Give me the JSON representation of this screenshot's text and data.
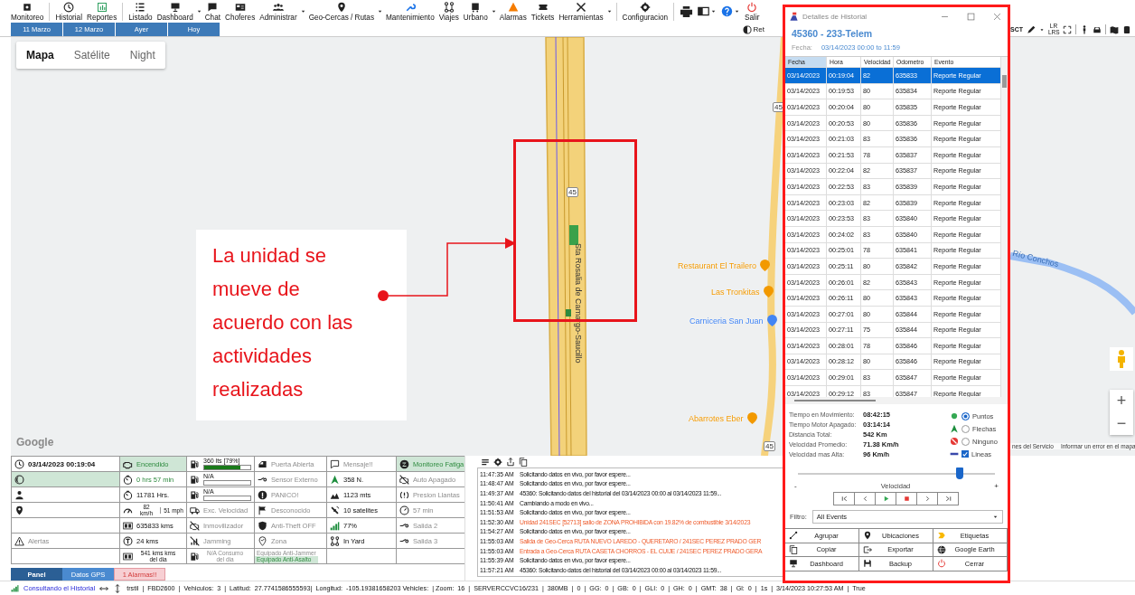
{
  "toolbar": [
    {
      "label": "Monitoreo",
      "dropdown": false
    },
    {
      "label": "Historial",
      "dropdown": false
    },
    {
      "label": "Reportes",
      "dropdown": false
    },
    {
      "label": "Listado",
      "dropdown": false
    },
    {
      "label": "Dashboard",
      "dropdown": true
    },
    {
      "label": "Chat",
      "dropdown": false
    },
    {
      "label": "Choferes",
      "dropdown": false
    },
    {
      "label": "Administrar",
      "dropdown": true
    },
    {
      "label": "Geo-Cercas / Rutas",
      "dropdown": true
    },
    {
      "label": "Mantenimiento",
      "dropdown": false
    },
    {
      "label": "Viajes",
      "dropdown": false
    },
    {
      "label": "Urbano",
      "dropdown": true
    },
    {
      "label": "Alarmas",
      "dropdown": false
    },
    {
      "label": "Tickets",
      "dropdown": false
    },
    {
      "label": "Herramientas",
      "dropdown": true
    },
    {
      "label": "Configuracion",
      "dropdown": false
    }
  ],
  "exit_label": "Salir",
  "date_tabs": [
    {
      "label": "11 Marzo"
    },
    {
      "label": "12 Marzo"
    },
    {
      "label": "Ayer"
    },
    {
      "label": "Hoy"
    }
  ],
  "right_tools": {
    "ret_label": "Ret",
    "sct_label": "SCT",
    "lr_label": "LR LRS"
  },
  "map": {
    "view_buttons": [
      {
        "label": "Mapa",
        "selected": true
      },
      {
        "label": "Satélite",
        "selected": false
      },
      {
        "label": "Night",
        "selected": false
      }
    ],
    "places": [
      {
        "name": "Restaurant El Trailero",
        "color": "#f29900"
      },
      {
        "name": "Las Tronkitas",
        "color": "#f29900"
      },
      {
        "name": "Carniceria San Juan",
        "color": "#4285f4"
      },
      {
        "name": "Abarrotes Eber",
        "color": "#f29900"
      }
    ],
    "road_name": "Sta Rosalia de Camargo-Saucillo",
    "route_shields": [
      "45",
      "45",
      "45"
    ],
    "river_name": "Río Conchos",
    "logo": "Google",
    "footer_links": [
      "nes del Servicio",
      "Informar un error en el mapa"
    ],
    "zoom_buttons": [
      "+",
      "−"
    ]
  },
  "annotation": {
    "text": "La unidad se mueve de acuerdo con las actividades realizadas"
  },
  "panel": {
    "rows": [
      [
        {
          "kind": "datetime",
          "text": "03/14/2023 00:19:04"
        },
        {
          "kind": "status",
          "text": "Encendido",
          "on": true
        },
        {
          "kind": "fuel",
          "text": "360 lts [79%]",
          "level": 0.79
        },
        {
          "kind": "status",
          "text": "Puerta Abierta",
          "on": false
        },
        {
          "kind": "status",
          "text": "Mensaje!!",
          "on": false
        },
        {
          "kind": "status",
          "text": "Monitoreo Fatiga",
          "on": true
        }
      ],
      [
        {
          "kind": "indicator",
          "on": true
        },
        {
          "kind": "value",
          "text": "0 hrs 57 min",
          "on": true
        },
        {
          "kind": "fuel",
          "text": "N/A"
        },
        {
          "kind": "status",
          "text": "Sensor Externo",
          "on": false
        },
        {
          "kind": "value",
          "text": "358 N.",
          "on": false
        },
        {
          "kind": "status",
          "text": "Auto Apagado",
          "on": false
        }
      ],
      [
        {
          "kind": "indicator",
          "on": false
        },
        {
          "kind": "value",
          "text": "11781 Hrs.",
          "on": false
        },
        {
          "kind": "fuel",
          "text": "N/A"
        },
        {
          "kind": "status",
          "text": "PANICO!",
          "on": false
        },
        {
          "kind": "value",
          "text": "1123 mts",
          "on": false
        },
        {
          "kind": "status",
          "text": "Presion Llantas",
          "on": false
        }
      ],
      [
        {
          "kind": "indicator",
          "on": false
        },
        {
          "kind": "speed",
          "texts": [
            "82 km/h",
            "51 mph"
          ]
        },
        {
          "kind": "status",
          "text": "Exc. Velocidad",
          "on": false
        },
        {
          "kind": "status",
          "text": "Desconocido",
          "on": false
        },
        {
          "kind": "value",
          "text": "10 satelites",
          "on": false
        },
        {
          "kind": "status",
          "text": "57 min",
          "on": false
        }
      ],
      [
        {
          "kind": "blank"
        },
        {
          "kind": "value",
          "text": "635833 kms",
          "on": false
        },
        {
          "kind": "status",
          "text": "Inmovilizador",
          "on": false
        },
        {
          "kind": "status",
          "text": "Anti-Theft OFF",
          "on": false
        },
        {
          "kind": "value",
          "text": "77%",
          "on": false
        },
        {
          "kind": "status",
          "text": "Salida 2",
          "on": false
        }
      ],
      [
        {
          "kind": "status",
          "text": "Alertas",
          "on": false
        },
        {
          "kind": "value",
          "text": "24 kms",
          "on": false
        },
        {
          "kind": "status",
          "text": "Jamming",
          "on": false
        },
        {
          "kind": "status",
          "text": "Zona",
          "on": false
        },
        {
          "kind": "value",
          "text": "In Yard",
          "on": false
        },
        {
          "kind": "status",
          "text": "Salida 3",
          "on": false
        }
      ],
      [
        {
          "kind": "blank"
        },
        {
          "kind": "stacked",
          "texts": [
            "541 kms",
            "kms del dia"
          ],
          "muted": false
        },
        {
          "kind": "stacked",
          "texts": [
            "N/A",
            "Consumo del dia"
          ],
          "muted": true
        },
        {
          "kind": "equipment",
          "items": [
            {
              "text": "Equipado Anti-Jammer",
              "on": false
            },
            {
              "text": "Equipado Anti-Asalto",
              "on": true
            }
          ]
        },
        {
          "kind": "blank"
        },
        {
          "kind": "blank"
        }
      ]
    ]
  },
  "panel_tabs": [
    {
      "label": "Panel",
      "selected": true,
      "kind": "normal"
    },
    {
      "label": "Datos GPS",
      "selected": false,
      "kind": "normal"
    },
    {
      "label": "1 Alarmas!!",
      "selected": false,
      "kind": "alert"
    }
  ],
  "log": [
    {
      "time": "11:47:35 AM",
      "message": "Solicitando datos en vivo, por favor espere...",
      "kind": "info"
    },
    {
      "time": "11:48:47 AM",
      "message": "Solicitando datos en vivo, por favor espere...",
      "kind": "info"
    },
    {
      "time": "11:49:37 AM",
      "message": "45360: Solicitando datos del historial del 03/14/2023 00:00 al 03/14/2023 11:59...",
      "kind": "info"
    },
    {
      "time": "11:50:41 AM",
      "message": "Cambiando a modo en vivo...",
      "kind": "info"
    },
    {
      "time": "11:51:53 AM",
      "message": "Solicitando datos en vivo, por favor espere...",
      "kind": "info"
    },
    {
      "time": "11:52:30 AM",
      "message": "Unidad 241SEC [52713]  salio de ZONA PROHIBIDA con 19.82% de combustible 3/14/2023",
      "kind": "alert"
    },
    {
      "time": "11:54:27 AM",
      "message": "Solicitando datos en vivo, por favor espere...",
      "kind": "info"
    },
    {
      "time": "11:55:03 AM",
      "message": "Salida de Geo-Cerca RUTA NUEVO LAREDO - QUERETARO / 241SEC PEREZ PRADO GER",
      "kind": "alert"
    },
    {
      "time": "11:55:03 AM",
      "message": "Entrada a Geo-Cerca RUTA CASETA CHORROS - EL CUIJE / 241SEC PEREZ PRADO GERA",
      "kind": "alert"
    },
    {
      "time": "11:55:39 AM",
      "message": "Solicitando datos en vivo, por favor espere...",
      "kind": "info"
    },
    {
      "time": "11:57:21 AM",
      "message": "45360: Solicitando datos del historial del 03/14/2023 00:00 al 03/14/2023 11:59...",
      "kind": "info"
    }
  ],
  "status_bar": {
    "activity": "Consultando el Historial",
    "details": "trstil  |  FBD2600  |  Vehiculos:  3  |  Latitud:  27.7741586555593|  Longitud:  -105.19381658203 Vehicles:  | Zoom:  16  |  SERVERCCVC16/231  |  380MB  |  0  |  GG:  0  |  GB:  0  |  GLI:  0  |  GH:  0  |  GMT:  38  |  Gl:  0  |  1s  |  3/14/2023 10:27:53 AM  |  True"
  },
  "history": {
    "title": "Detalles de Historial",
    "unit": "45360 - 233-Telem",
    "date_label": "Fecha:",
    "date_value": "03/14/2023 00:00 to 11:59",
    "columns": [
      {
        "label": "Fecha",
        "sorted": true
      },
      {
        "label": "Hora",
        "sorted": false
      },
      {
        "label": "Velocidad",
        "sorted": false
      },
      {
        "label": "Odometro",
        "sorted": false
      },
      {
        "label": "Evento",
        "sorted": false
      }
    ],
    "rows": [
      {
        "cells": [
          "03/14/2023",
          "00:19:04",
          "82",
          "635833",
          "Reporte Regular"
        ],
        "selected": true
      },
      {
        "cells": [
          "03/14/2023",
          "00:19:53",
          "80",
          "635834",
          "Reporte Regular"
        ],
        "selected": false
      },
      {
        "cells": [
          "03/14/2023",
          "00:20:04",
          "80",
          "635835",
          "Reporte Regular"
        ],
        "selected": false
      },
      {
        "cells": [
          "03/14/2023",
          "00:20:53",
          "80",
          "635836",
          "Reporte Regular"
        ],
        "selected": false
      },
      {
        "cells": [
          "03/14/2023",
          "00:21:03",
          "83",
          "635836",
          "Reporte Regular"
        ],
        "selected": false
      },
      {
        "cells": [
          "03/14/2023",
          "00:21:53",
          "78",
          "635837",
          "Reporte Regular"
        ],
        "selected": false
      },
      {
        "cells": [
          "03/14/2023",
          "00:22:04",
          "82",
          "635837",
          "Reporte Regular"
        ],
        "selected": false
      },
      {
        "cells": [
          "03/14/2023",
          "00:22:53",
          "83",
          "635839",
          "Reporte Regular"
        ],
        "selected": false
      },
      {
        "cells": [
          "03/14/2023",
          "00:23:03",
          "82",
          "635839",
          "Reporte Regular"
        ],
        "selected": false
      },
      {
        "cells": [
          "03/14/2023",
          "00:23:53",
          "83",
          "635840",
          "Reporte Regular"
        ],
        "selected": false
      },
      {
        "cells": [
          "03/14/2023",
          "00:24:02",
          "83",
          "635840",
          "Reporte Regular"
        ],
        "selected": false
      },
      {
        "cells": [
          "03/14/2023",
          "00:25:01",
          "78",
          "635841",
          "Reporte Regular"
        ],
        "selected": false
      },
      {
        "cells": [
          "03/14/2023",
          "00:25:11",
          "80",
          "635842",
          "Reporte Regular"
        ],
        "selected": false
      },
      {
        "cells": [
          "03/14/2023",
          "00:26:01",
          "82",
          "635843",
          "Reporte Regular"
        ],
        "selected": false
      },
      {
        "cells": [
          "03/14/2023",
          "00:26:11",
          "80",
          "635843",
          "Reporte Regular"
        ],
        "selected": false
      },
      {
        "cells": [
          "03/14/2023",
          "00:27:01",
          "80",
          "635844",
          "Reporte Regular"
        ],
        "selected": false
      },
      {
        "cells": [
          "03/14/2023",
          "00:27:11",
          "75",
          "635844",
          "Reporte Regular"
        ],
        "selected": false
      },
      {
        "cells": [
          "03/14/2023",
          "00:28:01",
          "78",
          "635846",
          "Reporte Regular"
        ],
        "selected": false
      },
      {
        "cells": [
          "03/14/2023",
          "00:28:12",
          "80",
          "635846",
          "Reporte Regular"
        ],
        "selected": false
      },
      {
        "cells": [
          "03/14/2023",
          "00:29:01",
          "83",
          "635847",
          "Reporte Regular"
        ],
        "selected": false
      },
      {
        "cells": [
          "03/14/2023",
          "00:29:12",
          "83",
          "635847",
          "Reporte Regular"
        ],
        "selected": false
      }
    ],
    "stats": [
      {
        "label": "Tiempo en Movimiento:",
        "value": "08:42:15"
      },
      {
        "label": "Tiempo Motor Apagado:",
        "value": "03:14:14"
      },
      {
        "label": "Distancia Total:",
        "value": "542 Km"
      },
      {
        "label": "Velocidad Promedio:",
        "value": "71.38 Km/h"
      },
      {
        "label": "Velocidad mas Alta:",
        "value": "96 Km/h"
      }
    ],
    "display_options": [
      {
        "label": "Puntos",
        "kind": "radio",
        "selected": true
      },
      {
        "label": "Flechas",
        "kind": "radio",
        "selected": false
      },
      {
        "label": "Ninguno",
        "kind": "radio",
        "selected": false
      },
      {
        "label": "Lineas",
        "kind": "checkbox",
        "checked": true
      }
    ],
    "speed_slider": {
      "level": 0.82,
      "label": "Velocidad",
      "min_label": "-",
      "max_label": "+"
    },
    "filter_label": "Filtro:",
    "filter_value": "All Events",
    "actions": [
      "Agrupar",
      "Ubicaciones",
      "Etiquetas",
      "Copiar",
      "Exportar",
      "Google Earth",
      "Dashboard",
      "Backup",
      "Cerrar"
    ]
  }
}
